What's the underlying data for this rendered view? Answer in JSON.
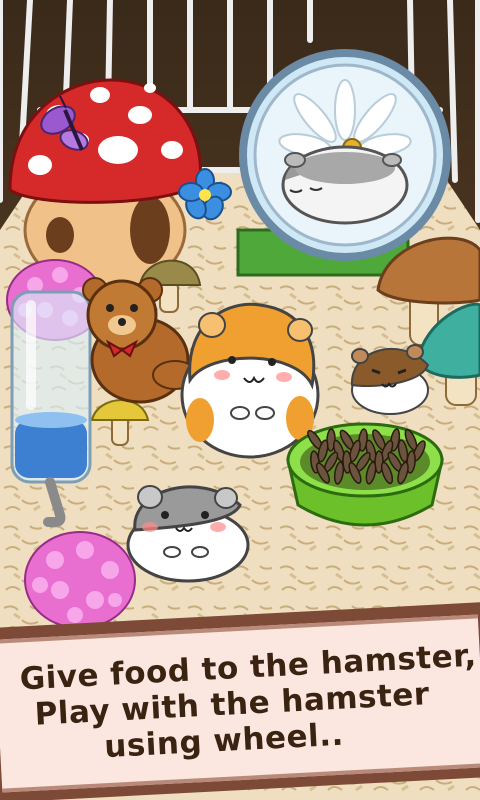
{
  "caption": {
    "line1": "Give food to the hamster,",
    "line2": "Play with the hamster",
    "line3": "using wheel.."
  },
  "colors": {
    "bedding": "#efdfc0",
    "mushroom_cap": "#d62a2a",
    "grass": "#4fa83a",
    "bowl": "#7ed43a",
    "hamster_orange": "#f0a030",
    "hamster_gray": "#9a9a9a",
    "banner_fill": "#fbe6e0",
    "banner_text": "#3b2312"
  }
}
